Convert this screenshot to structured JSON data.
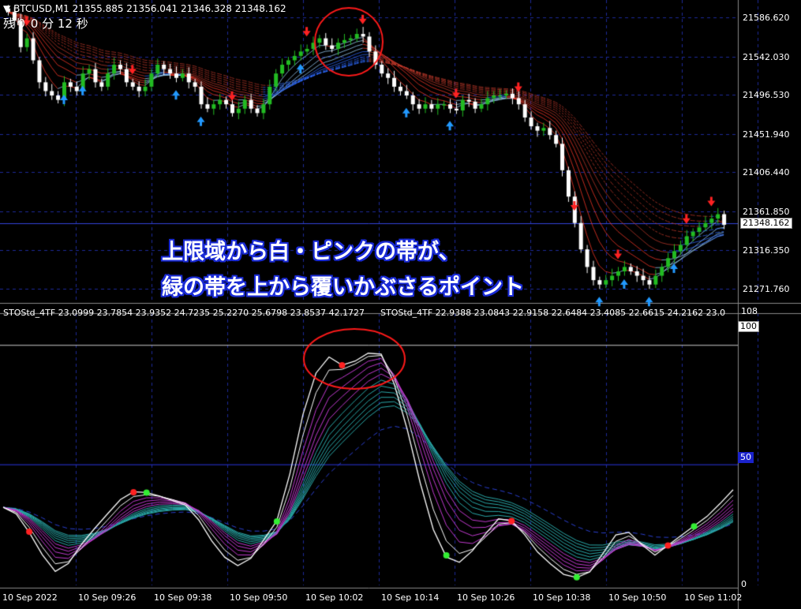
{
  "header": {
    "symbol": "BTCUSD,M1",
    "ohlc": "21355.885 21356.041 21346.328 21348.162",
    "countdown": "残り 0 分 12 秒"
  },
  "price_axis": {
    "labels": [
      "21586.620",
      "21542.030",
      "21496.530",
      "21451.940",
      "21406.440",
      "21361.850",
      "21316.350",
      "21271.760"
    ],
    "current_price": "21348.162"
  },
  "annotation": {
    "line1": "上限域から白・ピンクの帯が、",
    "line2": "緑の帯を上から覆いかぶさるポイント"
  },
  "oscillator": {
    "title": "STOStd_4TF 23.0999 23.7854 23.9352 24.7235 25.2270 25.6798 23.8537 42.1727",
    "title2": "STOStd_4TF 22.9388 23.0843 22.9158 22.6484 23.4085 22.6615 24.2162 23.0",
    "level_top": "108",
    "level_100": "100",
    "level_50": "50",
    "level_0": "0"
  },
  "time_axis": [
    "10 Sep 2022",
    "10 Sep 09:26",
    "10 Sep 09:38",
    "10 Sep 09:50",
    "10 Sep 10:02",
    "10 Sep 10:14",
    "10 Sep 10:26",
    "10 Sep 10:38",
    "10 Sep 10:50",
    "10 Sep 11:02"
  ],
  "colors": {
    "bull_candle": "#22bb22",
    "bear_candle": "#ffffff",
    "sell_arrow": "#ff2222",
    "buy_arrow": "#2299ff",
    "grid": "#1c2a9a",
    "highlight_circle": "#ff1a1a"
  },
  "chart_data": [
    {
      "type": "candlestick",
      "title": "BTCUSD,M1",
      "ylim": [
        21260,
        21600
      ],
      "close": [
        21590,
        21580,
        21550,
        21560,
        21535,
        21510,
        21500,
        21495,
        21490,
        21510,
        21505,
        21500,
        21520,
        21525,
        21510,
        21505,
        21520,
        21530,
        21525,
        21510,
        21505,
        21500,
        21505,
        21520,
        21530,
        21525,
        21520,
        21515,
        21520,
        21510,
        21505,
        21485,
        21480,
        21485,
        21490,
        21485,
        21475,
        21480,
        21490,
        21480,
        21475,
        21485,
        21505,
        21520,
        21530,
        21535,
        21540,
        21545,
        21548,
        21555,
        21560,
        21552,
        21548,
        21555,
        21558,
        21560,
        21565,
        21562,
        21545,
        21530,
        21520,
        21515,
        21505,
        21500,
        21495,
        21485,
        21480,
        21485,
        21480,
        21485,
        21485,
        21480,
        21478,
        21490,
        21488,
        21480,
        21485,
        21492,
        21495,
        21495,
        21497,
        21492,
        21485,
        21470,
        21460,
        21455,
        21458,
        21450,
        21440,
        21410,
        21380,
        21350,
        21320,
        21300,
        21285,
        21280,
        21285,
        21290,
        21295,
        21300,
        21295,
        21290,
        21285,
        21280,
        21290,
        21300,
        21310,
        21318,
        21325,
        21335,
        21340,
        21345,
        21350,
        21355,
        21360,
        21348
      ],
      "signals": {
        "sell_arrows": 17,
        "buy_arrows": 11
      }
    },
    {
      "type": "line",
      "title": "STOStd_4TF",
      "ylim": [
        0,
        108
      ],
      "levels": [
        50,
        100
      ],
      "series": [
        {
          "name": "STOStd_4TF",
          "values": [
            32,
            28,
            18,
            8,
            2,
            10,
            20,
            26,
            32,
            38,
            40,
            38,
            36,
            34,
            32,
            24,
            14,
            8,
            6,
            12,
            22,
            30,
            55,
            82,
            96,
            98,
            90,
            94,
            98,
            96,
            78,
            56,
            32,
            14,
            6,
            8,
            16,
            24,
            30,
            26,
            18,
            10,
            6,
            2,
            2,
            6,
            16,
            24,
            22,
            14,
            10,
            18,
            22,
            26,
            30,
            36,
            42
          ]
        }
      ]
    }
  ]
}
